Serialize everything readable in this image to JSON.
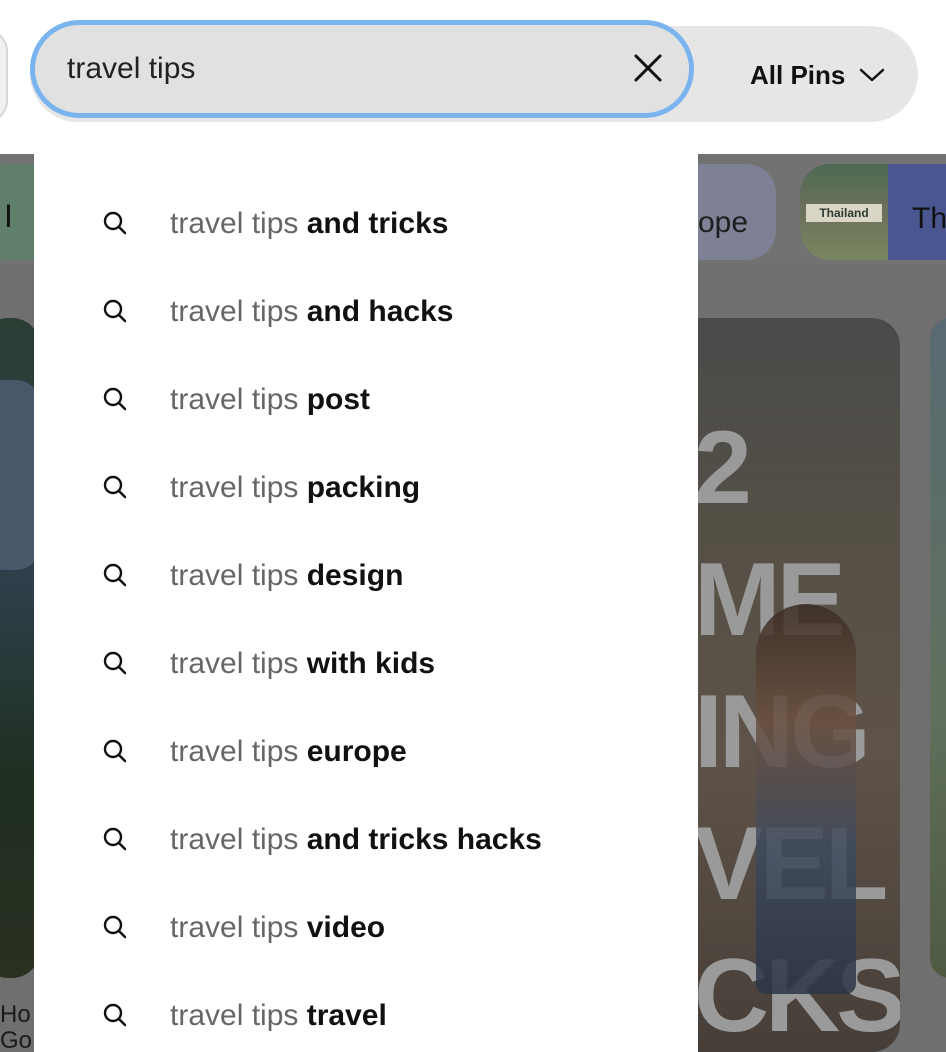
{
  "search": {
    "value": "travel tips",
    "placeholder": ""
  },
  "filter": {
    "label": "All Pins"
  },
  "background": {
    "chip_left_text": "I",
    "chip_europe_text": "ope",
    "chip_thailand_text": "Th",
    "chip_thailand_thumb_label": "Thailand",
    "pin_center_text": "2\nME\nING\nVEL\nCKS",
    "pin_left_caption": "Ho\nGo"
  },
  "suggestions": [
    {
      "prefix": "travel tips",
      "suffix": " and tricks"
    },
    {
      "prefix": "travel tips",
      "suffix": " and hacks"
    },
    {
      "prefix": "travel tips",
      "suffix": " post"
    },
    {
      "prefix": "travel tips",
      "suffix": " packing"
    },
    {
      "prefix": "travel tips",
      "suffix": " design"
    },
    {
      "prefix": "travel tips",
      "suffix": " with kids"
    },
    {
      "prefix": "travel tips",
      "suffix": " europe"
    },
    {
      "prefix": "travel tips",
      "suffix": " and tricks hacks"
    },
    {
      "prefix": "travel tips",
      "suffix": " video"
    },
    {
      "prefix": "travel tips",
      "suffix": " travel"
    }
  ],
  "icons": {
    "clear": "close-icon",
    "filter": "chevron-down-icon",
    "suggestion": "search-icon"
  },
  "colors": {
    "focus_ring": "#7ab4ef",
    "search_bg": "#e1e1e1",
    "prefix_text": "#666666",
    "suffix_text": "#111111"
  }
}
